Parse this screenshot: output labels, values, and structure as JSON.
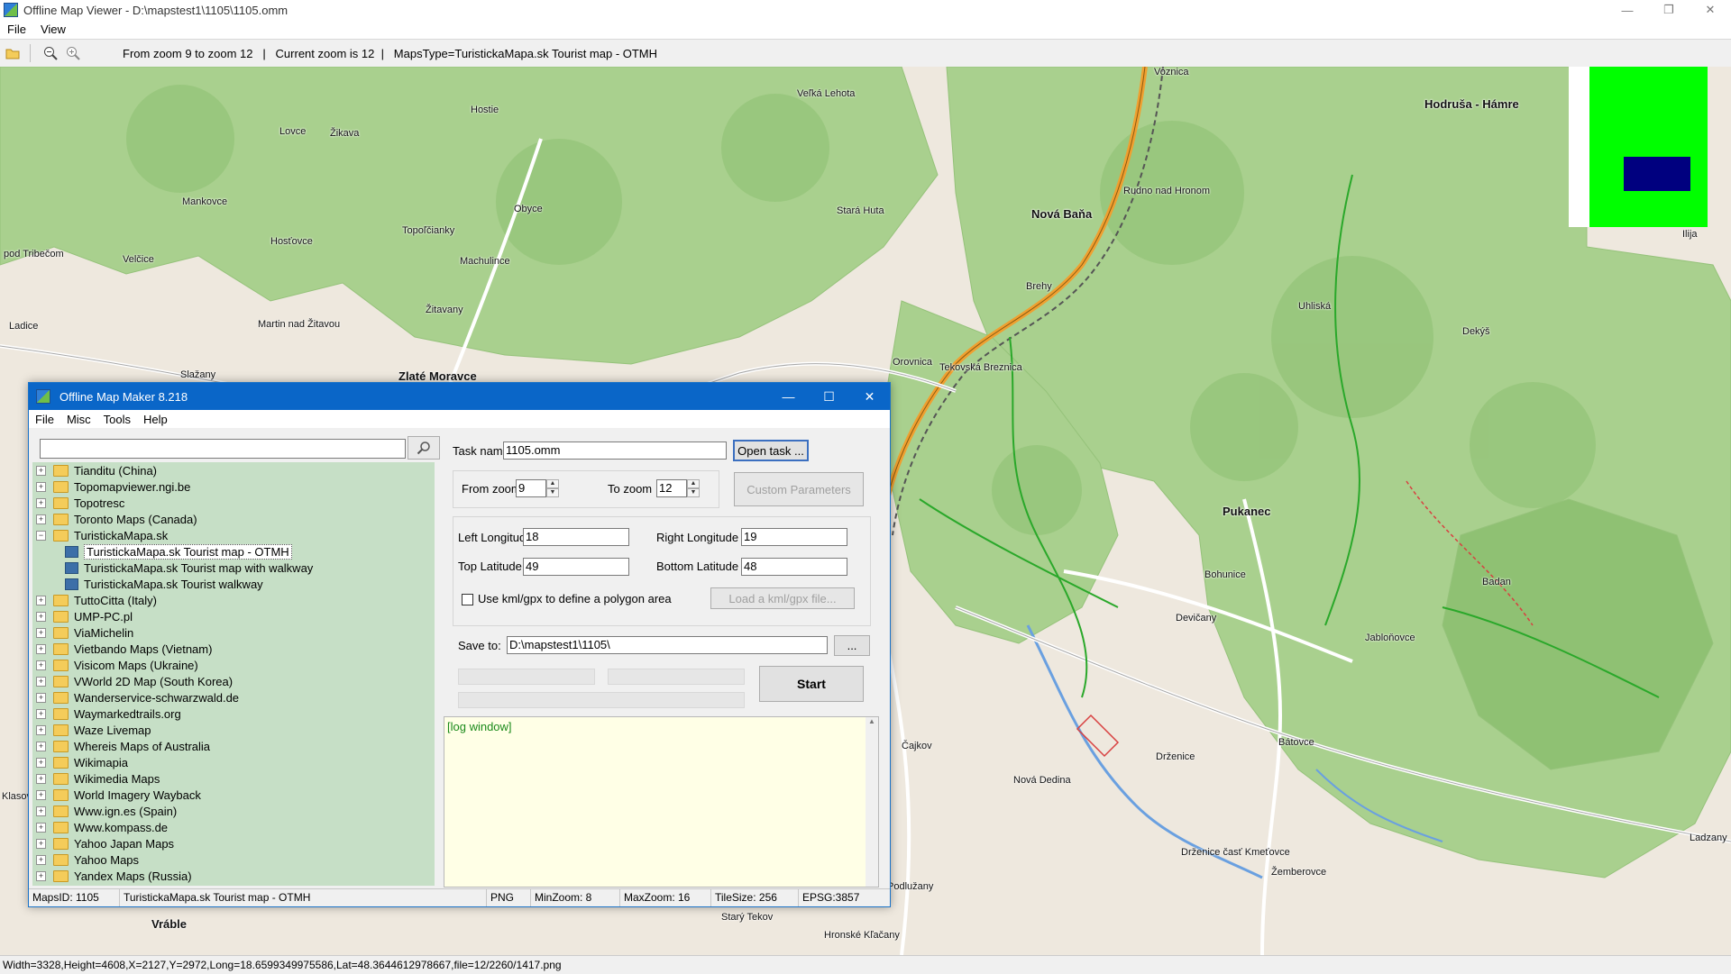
{
  "window": {
    "title": "Offline Map Viewer - D:\\mapstest1\\1105\\1105.omm",
    "minimize": "—",
    "maximize": "❐",
    "close": "✕"
  },
  "menu": {
    "file": "File",
    "view": "View"
  },
  "toolbar": {
    "status": "From zoom 9 to zoom 12   |   Current zoom is 12  |   MapsType=TuristickaMapa.sk Tourist map - OTMH"
  },
  "map": {
    "colors": {
      "forest": "#a9d08e",
      "forest_dark": "#8fc173",
      "open": "#efe8dc",
      "road_main": "#f0a030",
      "road": "#ffffff",
      "water": "#6aa0e0",
      "trail_green": "#2aa82a"
    },
    "labels": [
      {
        "t": "Hodruša - Hámre",
        "b": true
      },
      {
        "t": "Nová Baňa",
        "b": true
      },
      {
        "t": "Rudno nad Hronom"
      },
      {
        "t": "Veľká Lehota"
      },
      {
        "t": "Hostie"
      },
      {
        "t": "Obyce"
      },
      {
        "t": "Topoľčianky"
      },
      {
        "t": "Machulince"
      },
      {
        "t": "Žitavany"
      },
      {
        "t": "Martin nad Žitavou"
      },
      {
        "t": "Zlaté Moravce",
        "b": true
      },
      {
        "t": "Slažany"
      },
      {
        "t": "Ladice"
      },
      {
        "t": "Lovce"
      },
      {
        "t": "Žikava"
      },
      {
        "t": "Mankovce"
      },
      {
        "t": "Hosťovce"
      },
      {
        "t": "Velčice"
      },
      {
        "t": "Stará Huta"
      },
      {
        "t": "Brehy"
      },
      {
        "t": "Orovnica"
      },
      {
        "t": "Tekovská Breznica"
      },
      {
        "t": "Uhliská"
      },
      {
        "t": "Dekýš"
      },
      {
        "t": "Pukanec"
      },
      {
        "t": "Bohunice"
      },
      {
        "t": "Badan"
      },
      {
        "t": "Devičany"
      },
      {
        "t": "Jabloňovce"
      },
      {
        "t": "Čajkov"
      },
      {
        "t": "Nová Dedina"
      },
      {
        "t": "Drženice"
      },
      {
        "t": "Bátovce"
      },
      {
        "t": "Drženice časť Kmeťovce"
      },
      {
        "t": "Žemberovce"
      },
      {
        "t": "Podlužany"
      },
      {
        "t": "Vráble",
        "b": true
      },
      {
        "t": "Starý Tekov"
      },
      {
        "t": "Hronské Kľačany"
      },
      {
        "t": "Ilija"
      },
      {
        "t": "Ladzany"
      },
      {
        "t": "Voznica"
      },
      {
        "t": "pod Tribečom"
      },
      {
        "t": "Klasov"
      }
    ]
  },
  "status_bar": "Width=3328,Height=4608,X=2127,Y=2972,Long=18.6599349975586,Lat=48.3644612978667,file=12/2260/1417.png",
  "dialog": {
    "title": "Offline Map Maker 8.218",
    "minimize": "—",
    "maximize": "☐",
    "close": "✕",
    "menu": {
      "file": "File",
      "misc": "Misc",
      "tools": "Tools",
      "help": "Help"
    },
    "search": {
      "value": "",
      "placeholder": ""
    },
    "tree": [
      {
        "label": "Tianditu (China)",
        "type": "folder",
        "exp": "+"
      },
      {
        "label": "Topomapviewer.ngi.be",
        "type": "folder",
        "exp": "+"
      },
      {
        "label": "Topotresc",
        "type": "folder",
        "exp": "+"
      },
      {
        "label": "Toronto Maps (Canada)",
        "type": "folder",
        "exp": "+"
      },
      {
        "label": "TuristickaMapa.sk",
        "type": "folder",
        "exp": "−"
      },
      {
        "label": "TuristickaMapa.sk Tourist map - OTMH",
        "type": "map",
        "selected": true
      },
      {
        "label": "TuristickaMapa.sk Tourist map with walkway",
        "type": "map"
      },
      {
        "label": "TuristickaMapa.sk Tourist walkway",
        "type": "map"
      },
      {
        "label": "TuttoCitta (Italy)",
        "type": "folder",
        "exp": "+"
      },
      {
        "label": "UMP-PC.pl",
        "type": "folder",
        "exp": "+"
      },
      {
        "label": "ViaMichelin",
        "type": "folder",
        "exp": "+"
      },
      {
        "label": "Vietbando Maps (Vietnam)",
        "type": "folder",
        "exp": "+"
      },
      {
        "label": "Visicom Maps (Ukraine)",
        "type": "folder",
        "exp": "+"
      },
      {
        "label": "VWorld 2D Map (South Korea)",
        "type": "folder",
        "exp": "+"
      },
      {
        "label": "Wanderservice-schwarzwald.de",
        "type": "folder",
        "exp": "+"
      },
      {
        "label": "Waymarkedtrails.org",
        "type": "folder",
        "exp": "+"
      },
      {
        "label": "Waze Livemap",
        "type": "folder",
        "exp": "+"
      },
      {
        "label": "Whereis Maps of Australia",
        "type": "folder",
        "exp": "+"
      },
      {
        "label": "Wikimapia",
        "type": "folder",
        "exp": "+"
      },
      {
        "label": "Wikimedia Maps",
        "type": "folder",
        "exp": "+"
      },
      {
        "label": "World Imagery Wayback",
        "type": "folder",
        "exp": "+"
      },
      {
        "label": "Www.ign.es (Spain)",
        "type": "folder",
        "exp": "+"
      },
      {
        "label": "Www.kompass.de",
        "type": "folder",
        "exp": "+"
      },
      {
        "label": "Yahoo Japan Maps",
        "type": "folder",
        "exp": "+"
      },
      {
        "label": "Yahoo Maps",
        "type": "folder",
        "exp": "+"
      },
      {
        "label": "Yandex Maps (Russia)",
        "type": "folder",
        "exp": "+"
      }
    ],
    "form": {
      "task_name_label": "Task name",
      "task_name": "1105.omm",
      "open_task": "Open task ...",
      "from_zoom_label": "From zoom",
      "from_zoom": "9",
      "to_zoom_label": "To zoom",
      "to_zoom": "12",
      "custom_params": "Custom Parameters",
      "left_lon_label": "Left Longitude",
      "left_lon": "18",
      "right_lon_label": "Right Longitude",
      "right_lon": "19",
      "top_lat_label": "Top Latitude",
      "top_lat": "49",
      "bottom_lat_label": "Bottom Latitude",
      "bottom_lat": "48",
      "kml_label": "Use kml/gpx to define a polygon area",
      "kml_checked": false,
      "load_kml": "Load a kml/gpx file...",
      "save_to_label": "Save to:",
      "save_to": "D:\\mapstest1\\1105\\",
      "browse": "...",
      "start": "Start",
      "log": "[log window]"
    },
    "status": {
      "maps_id": "MapsID: 1105",
      "maps_name": "TuristickaMapa.sk Tourist map - OTMH",
      "format": "PNG",
      "min_zoom": "MinZoom: 8",
      "max_zoom": "MaxZoom: 16",
      "tile_size": "TileSize: 256",
      "epsg": "EPSG:3857"
    }
  }
}
